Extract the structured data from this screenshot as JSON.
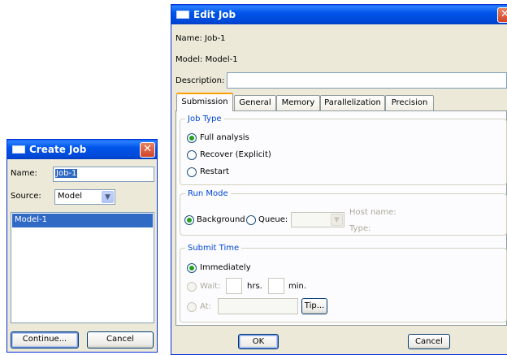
{
  "create_job": {
    "title": "Create Job",
    "close_glyph": "✕",
    "name_label": "Name:",
    "name_value": "Job-1",
    "source_label": "Source:",
    "source_value": "Model",
    "list_items": [
      "Model-1"
    ],
    "continue_label": "Continue...",
    "cancel_label": "Cancel"
  },
  "edit_job": {
    "title": "Edit Job",
    "close_glyph": "✕",
    "name_line": "Name:  Job-1",
    "model_line": "Model:  Model-1",
    "description_label": "Description:",
    "description_value": "",
    "tabs": [
      "Submission",
      "General",
      "Memory",
      "Parallelization",
      "Precision"
    ],
    "active_tab": "Submission",
    "job_type": {
      "legend": "Job Type",
      "options": [
        "Full analysis",
        "Recover (Explicit)",
        "Restart"
      ],
      "selected": "Full analysis"
    },
    "run_mode": {
      "legend": "Run Mode",
      "background_label": "Background",
      "queue_label": "Queue:",
      "queue_value": "",
      "host_name_label": "Host name:",
      "type_label": "Type:",
      "selected": "Background"
    },
    "submit_time": {
      "legend": "Submit Time",
      "immediately_label": "Immediately",
      "wait_label": "Wait:",
      "hrs_label": "hrs.",
      "min_label": "min.",
      "at_label": "At:",
      "tip_label": "Tip...",
      "selected": "Immediately"
    },
    "ok_label": "OK",
    "cancel_label": "Cancel"
  },
  "colors": {
    "titlebar": "#0055ea",
    "window_bg": "#ece9d8",
    "selection": "#316ac5",
    "group_legend": "#0046d5",
    "close_button": "#d2442b"
  }
}
